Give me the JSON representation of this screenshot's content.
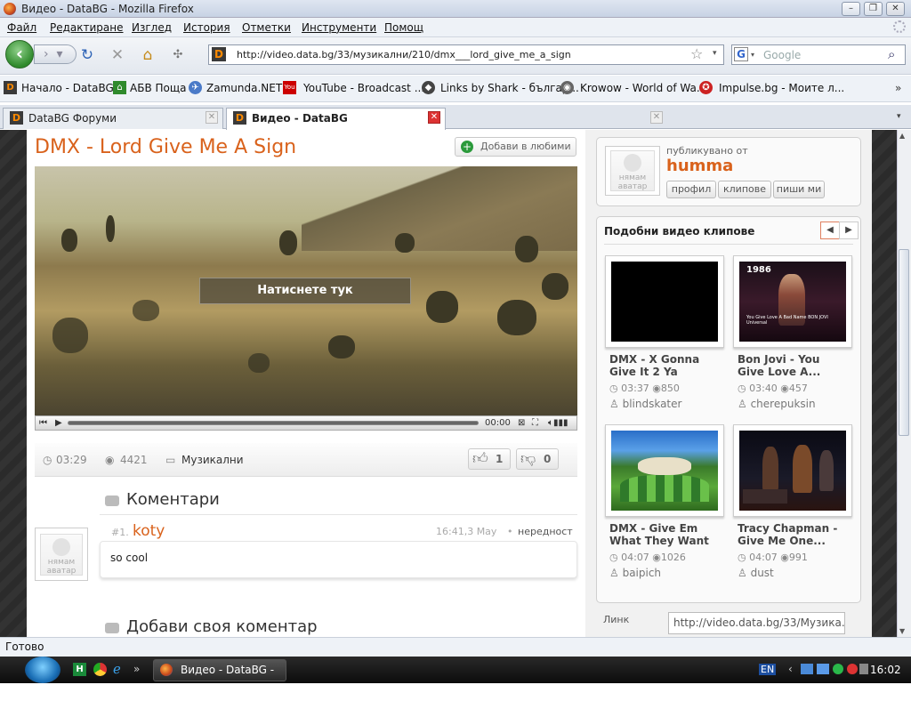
{
  "window": {
    "title": "Видео - DataBG - Mozilla Firefox"
  },
  "menu": [
    "Файл",
    "Редактиране",
    "Изглед",
    "История",
    "Отметки",
    "Инструменти",
    "Помощ"
  ],
  "nav": {
    "url": "http://video.data.bg/33/музикални/210/dmx___lord_give_me_a_sign",
    "search_placeholder": "Google"
  },
  "bookmarks": [
    "Начало - DataBG",
    "АБВ Поща",
    "Zamunda.NET",
    "YouTube - Broadcast ...",
    "Links by Shark - българ...",
    "Krowow - World of Wa...",
    "Impulse.bg - Моите л..."
  ],
  "tabs": [
    {
      "label": "DataBG Форуми",
      "active": false
    },
    {
      "label": "Видео - DataBG",
      "active": true
    }
  ],
  "video": {
    "title": "DMX - Lord Give Me A Sign",
    "add_favorites": "Добави в любими",
    "overlay_label": "Натиснете тук",
    "time": "00:00",
    "duration": "03:29",
    "views": "4421",
    "category": "Музикални",
    "likes": "1",
    "dislikes": "0"
  },
  "comments": {
    "heading": "Коментари",
    "items": [
      {
        "index": "#1.",
        "author": "koty",
        "time": "16:41,3 May",
        "report": "нередност",
        "text": "so cool"
      }
    ],
    "add_heading": "Добави своя коментар"
  },
  "avatar_placeholder": {
    "line1": "нямам",
    "line2": "аватар"
  },
  "publisher": {
    "label": "публикувано от",
    "name": "humma",
    "buttons": [
      "профил",
      "клипове",
      "пиши ми"
    ]
  },
  "similar": {
    "heading": "Подобни видео клипове",
    "items": [
      {
        "title_l1": "DMX - X Gonna",
        "title_l2": "Give It 2 Ya",
        "duration": "03:37",
        "views": "850",
        "user": "blindskater"
      },
      {
        "title_l1": "Bon Jovi - You",
        "title_l2": "Give Love A...",
        "duration": "03:40",
        "views": "457",
        "user": "cherepuksin"
      },
      {
        "title_l1": "DMX - Give Em",
        "title_l2": "What They Want",
        "duration": "04:07",
        "views": "1026",
        "user": "baipich"
      },
      {
        "title_l1": "Tracy Chapman -",
        "title_l2": "Give Me One...",
        "duration": "04:07",
        "views": "991",
        "user": "dust"
      }
    ],
    "thumb_text": {
      "year": "1986",
      "caption": "You Give Love A Bad Name BON JOVI Universal"
    }
  },
  "link": {
    "label": "Линк",
    "value": "http://video.data.bg/33/Музика..."
  },
  "status": {
    "text": "Готово"
  },
  "taskbar": {
    "item": "Видео - DataBG - ...",
    "lang": "EN",
    "clock": "16:02"
  }
}
